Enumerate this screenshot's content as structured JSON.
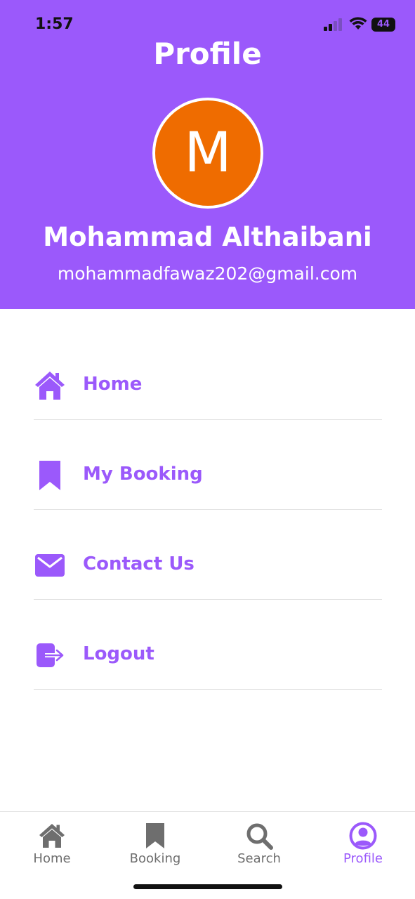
{
  "status_bar": {
    "time": "1:57",
    "battery": "44"
  },
  "header": {
    "title": "Profile",
    "avatar_letter": "M",
    "name": "Mohammad Althaibani",
    "email": "mohammadfawaz202@gmail.com"
  },
  "menu": {
    "items": [
      {
        "label": "Home",
        "icon": "house-icon"
      },
      {
        "label": "My Booking",
        "icon": "bookmark-icon"
      },
      {
        "label": "Contact Us",
        "icon": "envelope-icon"
      },
      {
        "label": "Logout",
        "icon": "logout-icon"
      }
    ]
  },
  "tabbar": {
    "tabs": [
      {
        "label": "Home",
        "icon": "house-icon",
        "active": false
      },
      {
        "label": "Booking",
        "icon": "bookmark-icon",
        "active": false
      },
      {
        "label": "Search",
        "icon": "search-icon",
        "active": false
      },
      {
        "label": "Profile",
        "icon": "user-circle-icon",
        "active": true
      }
    ]
  },
  "colors": {
    "accent": "#9b59fb",
    "avatar_bg": "#ef6c00",
    "inactive": "#6e6e6e"
  }
}
